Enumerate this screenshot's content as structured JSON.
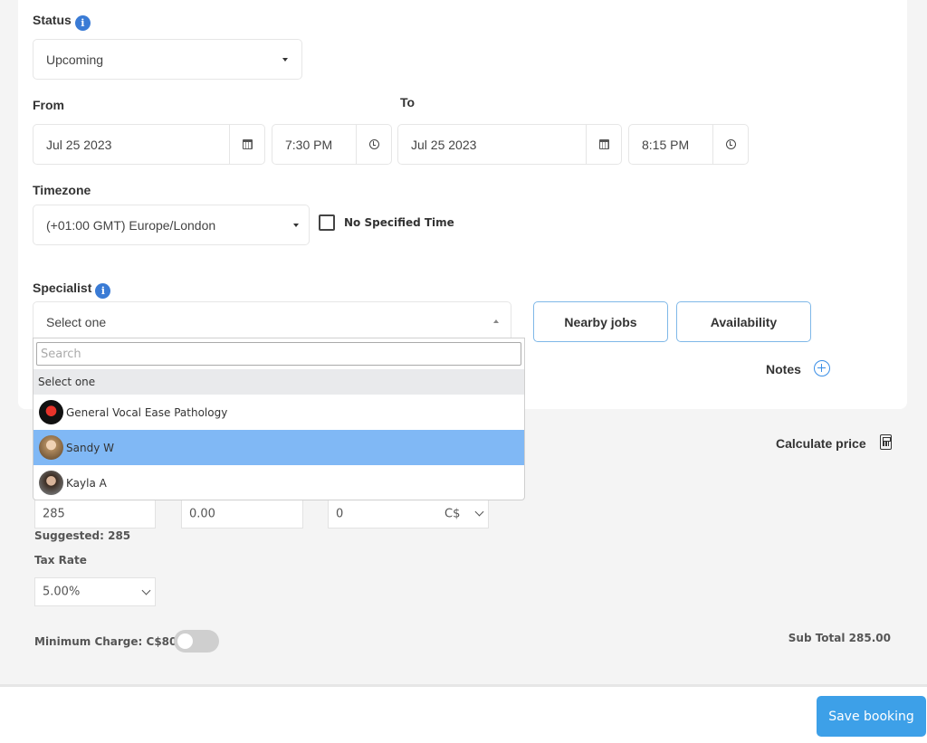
{
  "status": {
    "label": "Status",
    "value": "Upcoming",
    "info_icon": "i"
  },
  "from": {
    "label": "From",
    "date": "Jul 25 2023",
    "time": "7:30 PM"
  },
  "to": {
    "label": "To",
    "date": "Jul 25 2023",
    "time": "8:15 PM"
  },
  "timezone": {
    "label": "Timezone",
    "value": "(+01:00 GMT) Europe/London",
    "no_specified_time": "No Specified Time"
  },
  "specialist": {
    "label": "Specialist",
    "value": "Select one",
    "search_placeholder": "Search",
    "options": [
      {
        "name": "Select one",
        "avatar": ""
      },
      {
        "name": "General Vocal Ease Pathology",
        "avatar": "logo-avatar"
      },
      {
        "name": "Sandy W",
        "avatar": "person-avatar"
      },
      {
        "name": "Kayla A",
        "avatar": "person-avatar"
      }
    ],
    "highlighted": "Sandy W"
  },
  "buttons": {
    "nearby_jobs": "Nearby jobs",
    "availability": "Availability",
    "notes": "Notes",
    "calculate_price": "Calculate price",
    "save_booking": "Save booking"
  },
  "pricing": {
    "price": "285",
    "discount": "0.00",
    "extra": "0",
    "currency": "C$",
    "suggested": "Suggested: 285",
    "tax_rate_label": "Tax Rate",
    "tax_rate": "5.00%",
    "minimum_charge": "Minimum Charge: C$80",
    "sub_total": "Sub Total 285.00"
  },
  "colors": {
    "accent": "#3da0e8",
    "highlight": "#80b8f5",
    "info": "#3a7bd5"
  }
}
